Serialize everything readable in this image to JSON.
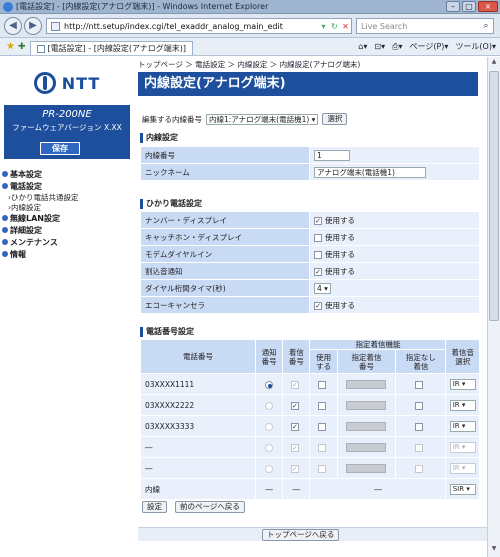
{
  "window": {
    "title": "[電話設定] - [内線設定(アナログ端末)] - Windows Internet Explorer"
  },
  "addressbar": {
    "url": "http://ntt.setup/index.cgi/tel_exaddr_analog_main_edit",
    "search_placeholder": "Live Search"
  },
  "tabbar": {
    "tab_label": "[電話設定] - [内線設定(アナログ端末)]",
    "page_menu": "ページ(P)",
    "tools_menu": "ツール(O)"
  },
  "sidebar": {
    "brand": "NTT",
    "model": "PR-200NE",
    "firmware": "ファームウェアバージョン X.XX",
    "save_label": "保存",
    "menu": [
      {
        "label": "基本設定"
      },
      {
        "label": "電話設定"
      },
      {
        "label": "ひかり電話共通設定",
        "sub": true
      },
      {
        "label": "内線設定",
        "sub": true
      },
      {
        "label": "無線LAN設定"
      },
      {
        "label": "詳細設定"
      },
      {
        "label": "メンテナンス"
      },
      {
        "label": "情報"
      }
    ]
  },
  "main": {
    "breadcrumb": "トップページ ＞ 電話設定 ＞ 内線設定 ＞ 内線設定(アナログ端末)",
    "page_title": "内線設定(アナログ端末)",
    "edit_label": "編集する内線番号",
    "edit_value": "内線1:アナログ端末(電話機1)",
    "select_button": "選択",
    "section_extension": "内線設定",
    "ext_number_label": "内線番号",
    "ext_number_value": "1",
    "nickname_label": "ニックネーム",
    "nickname_value": "アナログ端末(電話機1)",
    "section_hikari": "ひかり電話設定",
    "hikari_rows": [
      {
        "label": "ナンバー・ディスプレイ",
        "control": "checkbox",
        "checked": true,
        "text": "使用する"
      },
      {
        "label": "キャッチホン・ディスプレイ",
        "control": "checkbox",
        "checked": false,
        "text": "使用する"
      },
      {
        "label": "モデムダイヤルイン",
        "control": "checkbox",
        "checked": false,
        "text": "使用する"
      },
      {
        "label": "割込音通知",
        "control": "checkbox",
        "checked": true,
        "text": "使用する"
      },
      {
        "label": "ダイヤル桁間タイマ(秒)",
        "control": "select",
        "text": "4"
      },
      {
        "label": "エコーキャンセラ",
        "control": "checkbox",
        "checked": true,
        "text": "使用する"
      }
    ],
    "section_phone": "電話番号設定",
    "phone_headers": {
      "number": "電話番号",
      "notify": "通知\n番号",
      "incoming": "着信\n番号",
      "designated": "指定着信機能",
      "use": "使用\nする",
      "designated_number": "指定着信\n番号",
      "none_incoming": "指定なし\n着信",
      "ring": "着信音\n選択"
    },
    "phone_rows": [
      {
        "number": "03XXXX1111",
        "notify": "on",
        "incoming": "disabled-checked",
        "ring": "IR"
      },
      {
        "number": "03XXXX2222",
        "notify": "off",
        "incoming": "checked",
        "ring": "IR"
      },
      {
        "number": "03XXXX3333",
        "notify": "off",
        "incoming": "checked",
        "ring": "IR"
      },
      {
        "number": "―",
        "notify": "off",
        "incoming": "disabled-checked",
        "ring": "IR"
      },
      {
        "number": "―",
        "notify": "off",
        "incoming": "disabled-checked",
        "ring": "IR"
      }
    ],
    "internal_row": {
      "label": "内線",
      "notify": "―",
      "incoming": "―",
      "designated": "―",
      "ring": "SIR"
    },
    "set_button": "設定",
    "back_button": "前のページへ戻る",
    "top_button": "トップページへ戻る"
  }
}
